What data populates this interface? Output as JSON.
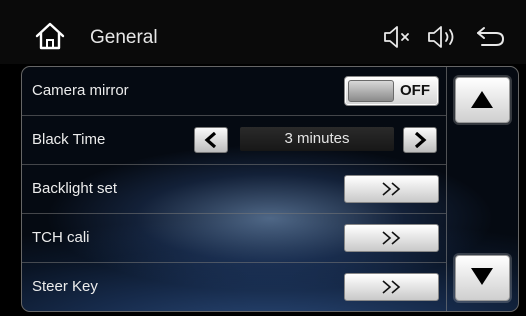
{
  "header": {
    "title": "General",
    "icons": [
      "home-icon",
      "mute-icon",
      "volume-icon",
      "back-icon"
    ]
  },
  "settings": [
    {
      "label": "Camera mirror",
      "control": "toggle",
      "value": "OFF"
    },
    {
      "label": "Black Time",
      "control": "stepper",
      "value": "3 minutes"
    },
    {
      "label": "Backlight set",
      "control": "arrow",
      "symbol": "≫"
    },
    {
      "label": "TCH cali",
      "control": "arrow",
      "symbol": "≫"
    },
    {
      "label": "Steer Key",
      "control": "arrow",
      "symbol": "≫"
    }
  ],
  "colors": {
    "background": "#000000",
    "button_light": "#ffffff",
    "accent_text": "#111111"
  }
}
